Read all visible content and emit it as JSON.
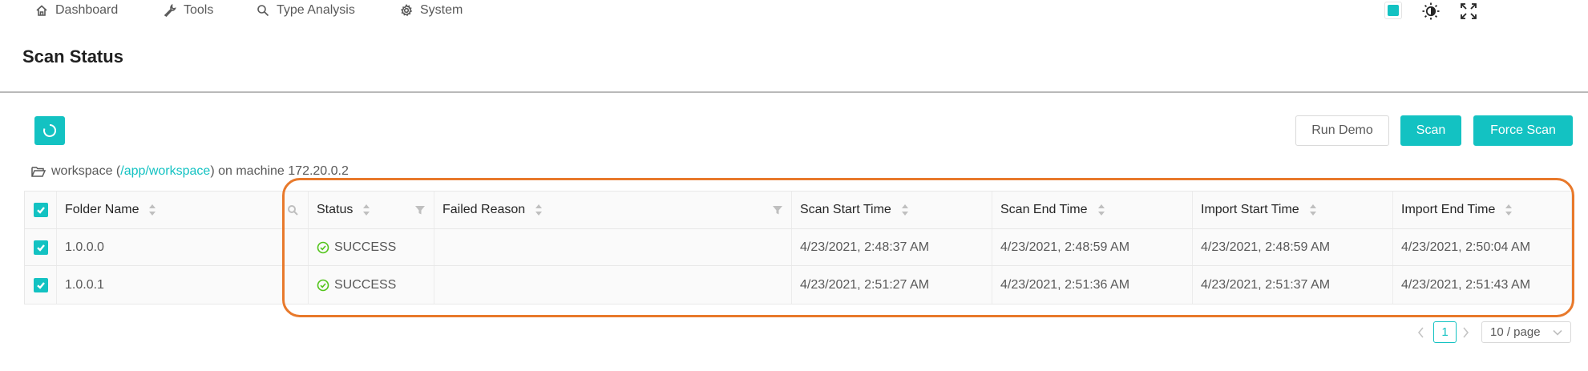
{
  "nav": {
    "items": [
      {
        "label": "Dashboard",
        "icon": "home-icon"
      },
      {
        "label": "Tools",
        "icon": "wrench-icon"
      },
      {
        "label": "Type Analysis",
        "icon": "search-icon"
      },
      {
        "label": "System",
        "icon": "gear-icon"
      }
    ],
    "tools": {
      "theme_color": "#13c2c2",
      "theme_icon": "theme-toggle-icon",
      "fullscreen_icon": "fullscreen-icon"
    }
  },
  "header": {
    "title": "Scan Status"
  },
  "toolbar": {
    "refresh_icon": "refresh-icon",
    "run_demo_label": "Run Demo",
    "scan_label": "Scan",
    "force_scan_label": "Force Scan"
  },
  "workspace": {
    "name": "workspace",
    "open_paren": " (",
    "path": "/app/workspace",
    "suffix": ") on machine 172.20.0.2"
  },
  "table": {
    "columns": [
      "Folder Name",
      "Status",
      "Failed Reason",
      "Scan Start Time",
      "Scan End Time",
      "Import Start Time",
      "Import End Time"
    ],
    "rows": [
      {
        "folder": "1.0.0.0",
        "status": "SUCCESS",
        "failed_reason": "",
        "scan_start": "4/23/2021, 2:48:37 AM",
        "scan_end": "4/23/2021, 2:48:59 AM",
        "import_start": "4/23/2021, 2:48:59 AM",
        "import_end": "4/23/2021, 2:50:04 AM"
      },
      {
        "folder": "1.0.0.1",
        "status": "SUCCESS",
        "failed_reason": "",
        "scan_start": "4/23/2021, 2:51:27 AM",
        "scan_end": "4/23/2021, 2:51:36 AM",
        "import_start": "4/23/2021, 2:51:37 AM",
        "import_end": "4/23/2021, 2:51:43 AM"
      }
    ]
  },
  "pagination": {
    "current_page": "1",
    "page_size": "10 / page"
  },
  "colors": {
    "accent": "#13c2c2",
    "success": "#52c41a",
    "highlight": "#e8792b"
  }
}
